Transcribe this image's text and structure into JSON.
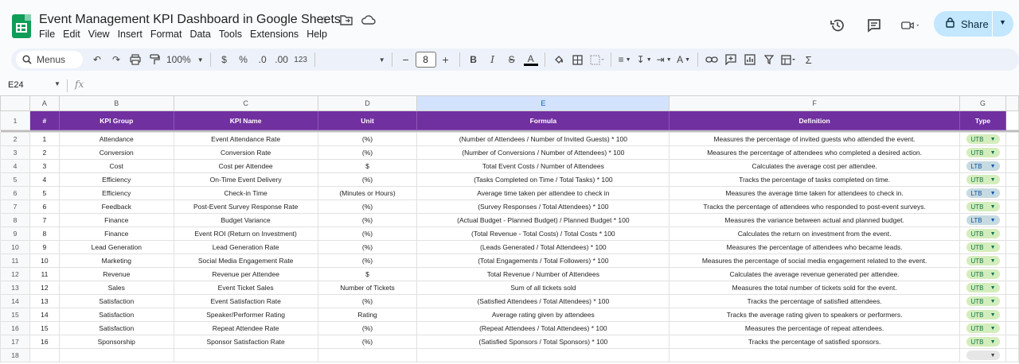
{
  "doc": {
    "title": "Event Management KPI Dashboard in Google Sheets",
    "menu": [
      "File",
      "Edit",
      "View",
      "Insert",
      "Format",
      "Data",
      "Tools",
      "Extensions",
      "Help"
    ],
    "share_label": "Share"
  },
  "toolbar": {
    "search_label": "Menus",
    "zoom": "100%",
    "currency": "$",
    "percent": "%",
    "decrease_decimal": ".0",
    "increase_decimal": ".00",
    "number_format": "123",
    "font_size": "8"
  },
  "formula_bar": {
    "cell_ref": "E24",
    "fx": "fx"
  },
  "sheet": {
    "columns": [
      "A",
      "B",
      "C",
      "D",
      "E",
      "F",
      "G"
    ],
    "selected_column": "E",
    "header_row": [
      "#",
      "KPI Group",
      "KPI Name",
      "Unit",
      "Formula",
      "Definition",
      "Type"
    ],
    "rows": [
      {
        "n": "1",
        "group": "Attendance",
        "name": "Event Attendance Rate",
        "unit": "(%)",
        "formula": "(Number of Attendees / Number of Invited Guests) * 100",
        "definition": "Measures the percentage of invited guests who attended the event.",
        "type": "UTB"
      },
      {
        "n": "2",
        "group": "Conversion",
        "name": "Conversion Rate",
        "unit": "(%)",
        "formula": "(Number of Conversions / Number of Attendees) * 100",
        "definition": "Measures the percentage of attendees who completed a desired action.",
        "type": "UTB"
      },
      {
        "n": "3",
        "group": "Cost",
        "name": "Cost per Attendee",
        "unit": "$",
        "formula": "Total Event Costs / Number of Attendees",
        "definition": "Calculates the average cost per attendee.",
        "type": "LTB"
      },
      {
        "n": "4",
        "group": "Efficiency",
        "name": "On-Time Event Delivery",
        "unit": "(%)",
        "formula": "(Tasks Completed on Time / Total Tasks) * 100",
        "definition": "Tracks the percentage of tasks completed on time.",
        "type": "UTB"
      },
      {
        "n": "5",
        "group": "Efficiency",
        "name": "Check-in Time",
        "unit": "(Minutes or Hours)",
        "formula": "Average time taken per attendee to check in",
        "definition": "Measures the average time taken for attendees to check in.",
        "type": "LTB"
      },
      {
        "n": "6",
        "group": "Feedback",
        "name": "Post-Event Survey Response Rate",
        "unit": "(%)",
        "formula": "(Survey Responses / Total Attendees) * 100",
        "definition": "Tracks the percentage of attendees who responded to post-event surveys.",
        "type": "UTB"
      },
      {
        "n": "7",
        "group": "Finance",
        "name": "Budget Variance",
        "unit": "(%)",
        "formula": "(Actual Budget - Planned Budget) / Planned Budget * 100",
        "definition": "Measures the variance between actual and planned budget.",
        "type": "LTB"
      },
      {
        "n": "8",
        "group": "Finance",
        "name": "Event ROI (Return on Investment)",
        "unit": "(%)",
        "formula": "(Total Revenue - Total Costs) / Total Costs * 100",
        "definition": "Calculates the return on investment from the event.",
        "type": "UTB"
      },
      {
        "n": "9",
        "group": "Lead Generation",
        "name": "Lead Generation Rate",
        "unit": "(%)",
        "formula": "(Leads Generated / Total Attendees) * 100",
        "definition": "Measures the percentage of attendees who became leads.",
        "type": "UTB"
      },
      {
        "n": "10",
        "group": "Marketing",
        "name": "Social Media Engagement Rate",
        "unit": "(%)",
        "formula": "(Total Engagements / Total Followers) * 100",
        "definition": "Measures the percentage of social media engagement related to the event.",
        "type": "UTB"
      },
      {
        "n": "11",
        "group": "Revenue",
        "name": "Revenue per Attendee",
        "unit": "$",
        "formula": "Total Revenue / Number of Attendees",
        "definition": "Calculates the average revenue generated per attendee.",
        "type": "UTB"
      },
      {
        "n": "12",
        "group": "Sales",
        "name": "Event Ticket Sales",
        "unit": "Number of Tickets",
        "formula": "Sum of all tickets sold",
        "definition": "Measures the total number of tickets sold for the event.",
        "type": "UTB"
      },
      {
        "n": "13",
        "group": "Satisfaction",
        "name": "Event Satisfaction Rate",
        "unit": "(%)",
        "formula": "(Satisfied Attendees / Total Attendees) * 100",
        "definition": "Tracks the percentage of satisfied attendees.",
        "type": "UTB"
      },
      {
        "n": "14",
        "group": "Satisfaction",
        "name": "Speaker/Performer Rating",
        "unit": "Rating",
        "formula": "Average rating given by attendees",
        "definition": "Tracks the average rating given to speakers or performers.",
        "type": "UTB"
      },
      {
        "n": "15",
        "group": "Satisfaction",
        "name": "Repeat Attendee Rate",
        "unit": "(%)",
        "formula": "(Repeat Attendees / Total Attendees) * 100",
        "definition": "Measures the percentage of repeat attendees.",
        "type": "UTB"
      },
      {
        "n": "16",
        "group": "Sponsorship",
        "name": "Sponsor Satisfaction Rate",
        "unit": "(%)",
        "formula": "(Satisfied Sponsors / Total Sponsors) * 100",
        "definition": "Tracks the percentage of satisfied sponsors.",
        "type": "UTB"
      }
    ]
  },
  "colors": {
    "header_purple": "#7030a0",
    "utb_chip": "#d4edbc",
    "ltb_chip": "#c6dbe1",
    "share_button": "#c2e7ff"
  }
}
